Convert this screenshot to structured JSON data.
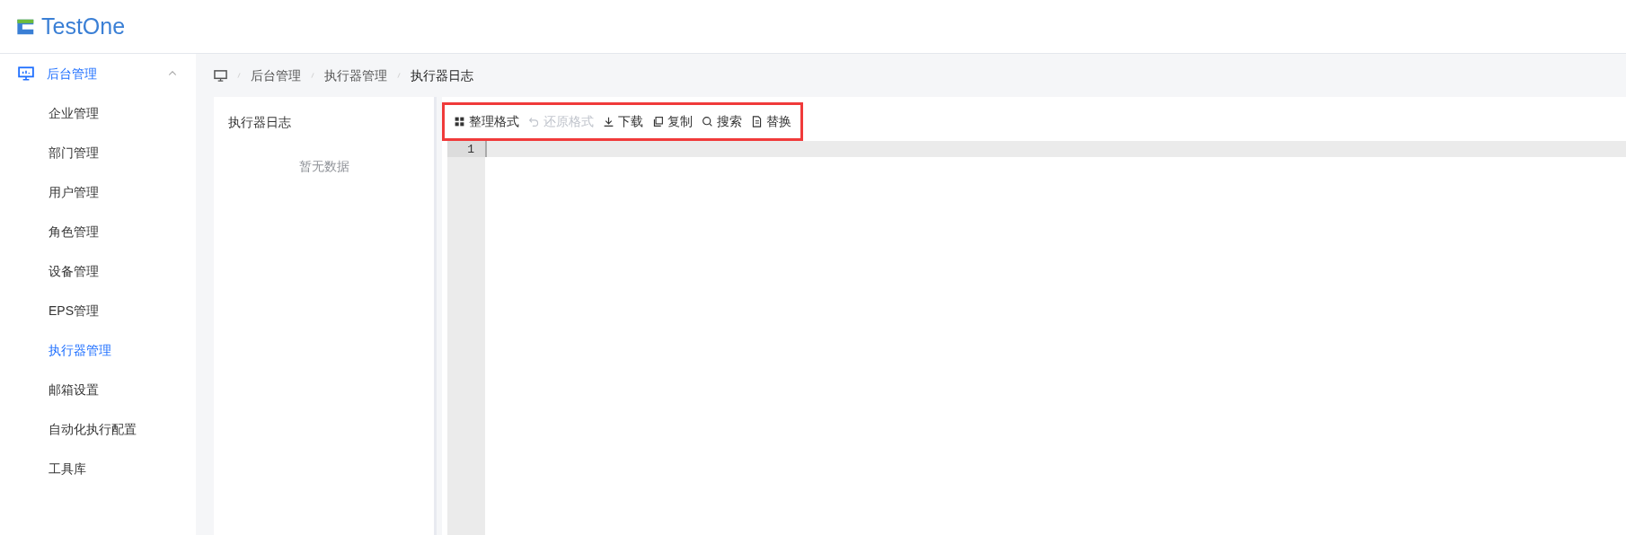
{
  "logo": {
    "text": "TestOne"
  },
  "sidebar": {
    "group": {
      "label": "后台管理",
      "expanded": true,
      "selected": true
    },
    "items": [
      {
        "label": "企业管理",
        "selected": false
      },
      {
        "label": "部门管理",
        "selected": false
      },
      {
        "label": "用户管理",
        "selected": false
      },
      {
        "label": "角色管理",
        "selected": false
      },
      {
        "label": "设备管理",
        "selected": false
      },
      {
        "label": "EPS管理",
        "selected": false
      },
      {
        "label": "执行器管理",
        "selected": true
      },
      {
        "label": "邮箱设置",
        "selected": false
      },
      {
        "label": "自动化执行配置",
        "selected": false
      },
      {
        "label": "工具库",
        "selected": false
      }
    ]
  },
  "breadcrumb": [
    "后台管理",
    "执行器管理",
    "执行器日志"
  ],
  "log_panel": {
    "title": "执行器日志",
    "empty_text": "暂无数据"
  },
  "toolbar": {
    "highlighted": true,
    "buttons": [
      {
        "label": "整理格式",
        "kind": "format",
        "disabled": false
      },
      {
        "label": "还原格式",
        "kind": "undo",
        "disabled": true
      },
      {
        "label": "下载",
        "kind": "download",
        "disabled": false
      },
      {
        "label": "复制",
        "kind": "copy",
        "disabled": false
      },
      {
        "label": "搜索",
        "kind": "search",
        "disabled": false
      },
      {
        "label": "替换",
        "kind": "replace",
        "disabled": false
      }
    ]
  },
  "editor": {
    "line_numbers": [
      "1"
    ]
  }
}
